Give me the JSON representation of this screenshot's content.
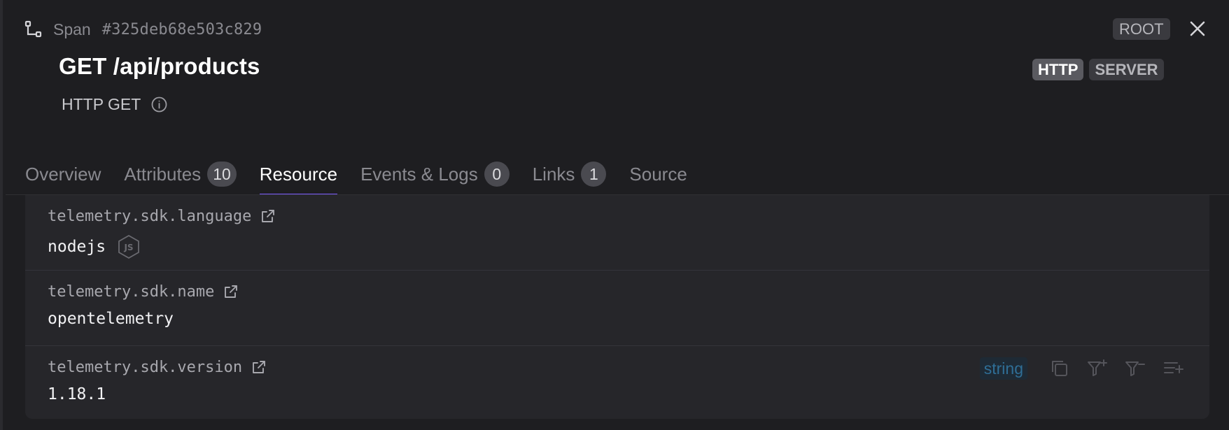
{
  "header": {
    "span_word": "Span",
    "span_id": "#325deb68e503c829",
    "root_badge": "ROOT",
    "title": "GET /api/products",
    "subtitle": "HTTP GET",
    "badges": [
      "HTTP",
      "SERVER"
    ]
  },
  "tabs": [
    {
      "label": "Overview",
      "count": null
    },
    {
      "label": "Attributes",
      "count": "10"
    },
    {
      "label": "Resource",
      "count": null,
      "active": true
    },
    {
      "label": "Events & Logs",
      "count": "0"
    },
    {
      "label": "Links",
      "count": "1"
    },
    {
      "label": "Source",
      "count": null
    }
  ],
  "resource": {
    "rows": [
      {
        "key": "telemetry.sdk.language",
        "value": "nodejs",
        "icon": "nodejs-icon"
      },
      {
        "key": "telemetry.sdk.name",
        "value": "opentelemetry"
      },
      {
        "key": "telemetry.sdk.version",
        "value": "1.18.1",
        "type": "string"
      }
    ]
  },
  "colors": {
    "accent": "#7c5cff",
    "background": "#1e1e21",
    "list_background": "#26262a",
    "type_badge_text": "#2f6e96"
  }
}
